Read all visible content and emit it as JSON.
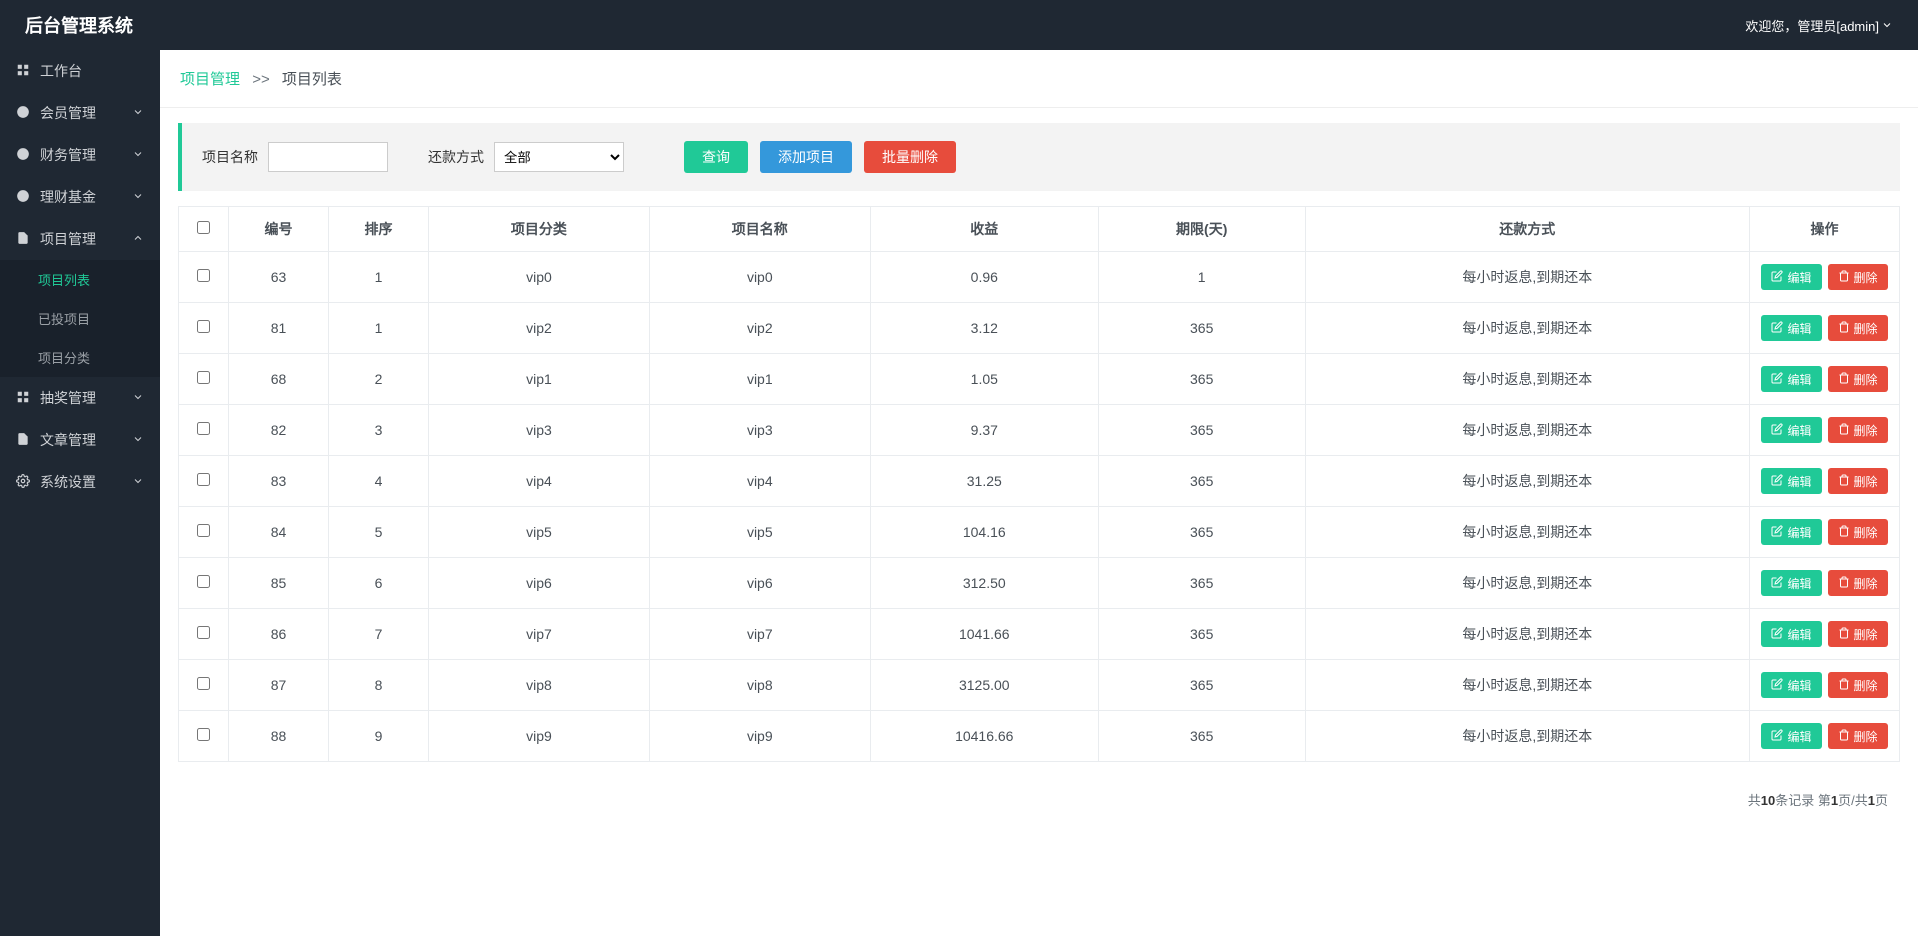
{
  "header": {
    "brand": "后台管理系统",
    "welcome_prefix": "欢迎您，",
    "welcome_role": "管理员[admin]"
  },
  "sidebar": {
    "items": [
      {
        "icon": "dashboard-icon",
        "label": "工作台",
        "chevron": false
      },
      {
        "icon": "user-icon",
        "label": "会员管理",
        "chevron": true
      },
      {
        "icon": "money-icon",
        "label": "财务管理",
        "chevron": true
      },
      {
        "icon": "fund-icon",
        "label": "理财基金",
        "chevron": true
      },
      {
        "icon": "project-icon",
        "label": "项目管理",
        "chevron": true,
        "expanded": true,
        "sub": [
          {
            "label": "项目列表",
            "active": true
          },
          {
            "label": "已投项目",
            "active": false
          },
          {
            "label": "项目分类",
            "active": false
          }
        ]
      },
      {
        "icon": "lottery-icon",
        "label": "抽奖管理",
        "chevron": true
      },
      {
        "icon": "article-icon",
        "label": "文章管理",
        "chevron": true
      },
      {
        "icon": "settings-icon",
        "label": "系统设置",
        "chevron": true
      }
    ]
  },
  "breadcrumb": {
    "module": "项目管理",
    "sep": ">>",
    "current": "项目列表"
  },
  "filter": {
    "name_label": "项目名称",
    "name_value": "",
    "repay_label": "还款方式",
    "repay_options": [
      "全部"
    ],
    "repay_selected": "全部",
    "search_label": "查询",
    "add_label": "添加项目",
    "batchdel_label": "批量删除"
  },
  "table": {
    "columns": [
      "",
      "编号",
      "排序",
      "项目分类",
      "项目名称",
      "收益",
      "期限(天)",
      "还款方式",
      "操作"
    ],
    "edit_label": "编辑",
    "delete_label": "删除",
    "rows": [
      {
        "id": "63",
        "sort": "1",
        "cat": "vip0",
        "name": "vip0",
        "profit": "0.96",
        "term": "1",
        "repay": "每小时返息,到期还本"
      },
      {
        "id": "81",
        "sort": "1",
        "cat": "vip2",
        "name": "vip2",
        "profit": "3.12",
        "term": "365",
        "repay": "每小时返息,到期还本"
      },
      {
        "id": "68",
        "sort": "2",
        "cat": "vip1",
        "name": "vip1",
        "profit": "1.05",
        "term": "365",
        "repay": "每小时返息,到期还本"
      },
      {
        "id": "82",
        "sort": "3",
        "cat": "vip3",
        "name": "vip3",
        "profit": "9.37",
        "term": "365",
        "repay": "每小时返息,到期还本"
      },
      {
        "id": "83",
        "sort": "4",
        "cat": "vip4",
        "name": "vip4",
        "profit": "31.25",
        "term": "365",
        "repay": "每小时返息,到期还本"
      },
      {
        "id": "84",
        "sort": "5",
        "cat": "vip5",
        "name": "vip5",
        "profit": "104.16",
        "term": "365",
        "repay": "每小时返息,到期还本"
      },
      {
        "id": "85",
        "sort": "6",
        "cat": "vip6",
        "name": "vip6",
        "profit": "312.50",
        "term": "365",
        "repay": "每小时返息,到期还本"
      },
      {
        "id": "86",
        "sort": "7",
        "cat": "vip7",
        "name": "vip7",
        "profit": "1041.66",
        "term": "365",
        "repay": "每小时返息,到期还本"
      },
      {
        "id": "87",
        "sort": "8",
        "cat": "vip8",
        "name": "vip8",
        "profit": "3125.00",
        "term": "365",
        "repay": "每小时返息,到期还本"
      },
      {
        "id": "88",
        "sort": "9",
        "cat": "vip9",
        "name": "vip9",
        "profit": "10416.66",
        "term": "365",
        "repay": "每小时返息,到期还本"
      }
    ]
  },
  "paging": {
    "text_prefix": "共",
    "total": "10",
    "text_mid1": "条记录 第",
    "page": "1",
    "text_mid2": "页/共",
    "pages": "1",
    "text_suffix": "页"
  }
}
